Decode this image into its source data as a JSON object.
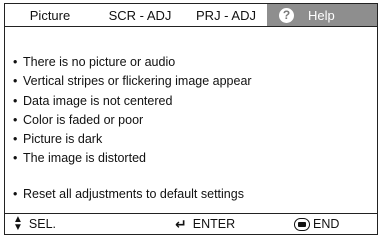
{
  "tabs": {
    "picture": "Picture",
    "scr_adj": "SCR - ADJ",
    "prj_adj": "PRJ - ADJ",
    "help": "Help",
    "help_icon_glyph": "?"
  },
  "items": [
    "There is no picture or audio",
    "Vertical stripes or flickering image appear",
    "Data image is not centered",
    "Color is faded or poor",
    "Picture is dark",
    "The image is distorted"
  ],
  "reset": "Reset all adjustments to default settings",
  "footer": {
    "sel": "SEL.",
    "enter": "ENTER",
    "end": "END"
  },
  "colors": {
    "active_tab_bg": "#8e8e8e",
    "border": "#222222"
  },
  "icons": [
    "question-icon",
    "up-down-arrows-icon",
    "enter-arrow-icon",
    "end-button-icon"
  ]
}
